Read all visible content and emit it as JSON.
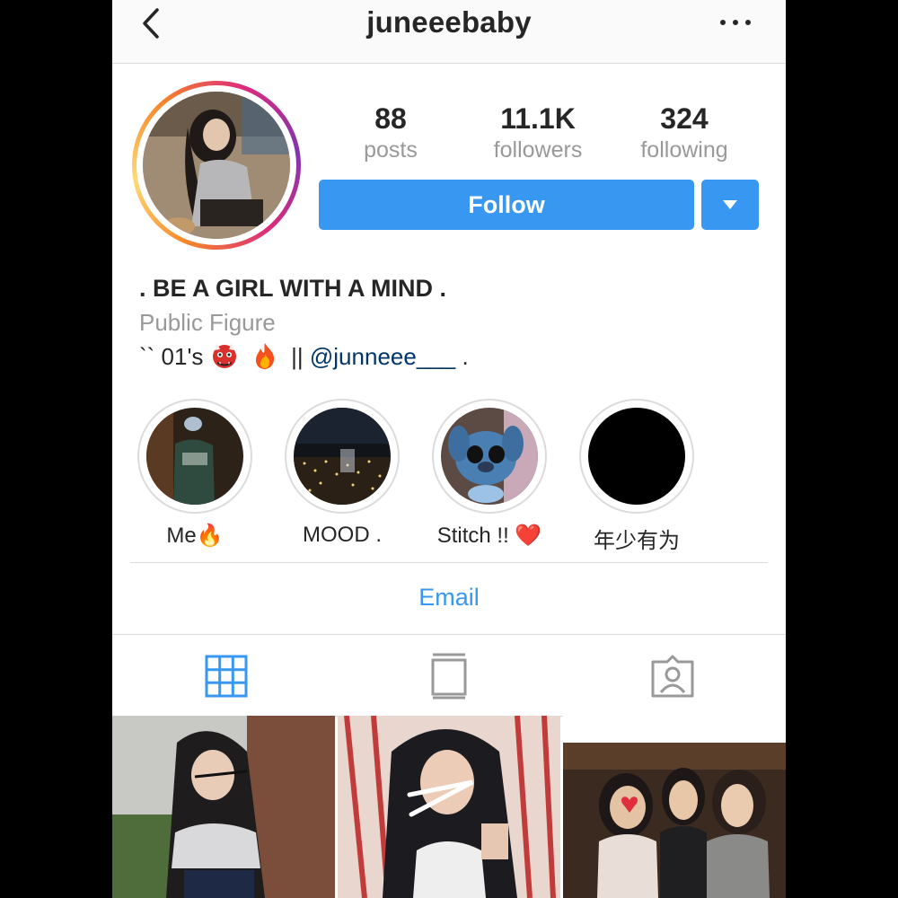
{
  "header": {
    "username": "juneeebaby"
  },
  "stats": [
    {
      "value": "88",
      "label": "posts"
    },
    {
      "value": "11.1K",
      "label": "followers"
    },
    {
      "value": "324",
      "label": "following"
    }
  ],
  "actions": {
    "follow_label": "Follow"
  },
  "bio": {
    "name": ". BE A GIRL WITH A MIND .",
    "category": "Public Figure",
    "line_prefix": "`` 01's",
    "line_sep": "||",
    "mention": "@junneee___",
    "line_suffix": "."
  },
  "highlights": [
    {
      "label": "Me🔥"
    },
    {
      "label": "MOOD ."
    },
    {
      "label": "Stitch !! ❤️"
    },
    {
      "label": "年少有为"
    }
  ],
  "contact": {
    "email_label": "Email"
  },
  "colors": {
    "accent": "#3897f0",
    "mention": "#003569",
    "muted": "#999999",
    "border": "#dbdbdb"
  },
  "icons": {
    "back": "chevron-left-icon",
    "more": "more-horizontal-icon",
    "grid_tab": "grid-icon",
    "feed_tab": "feed-icon",
    "tagged_tab": "tagged-icon"
  }
}
